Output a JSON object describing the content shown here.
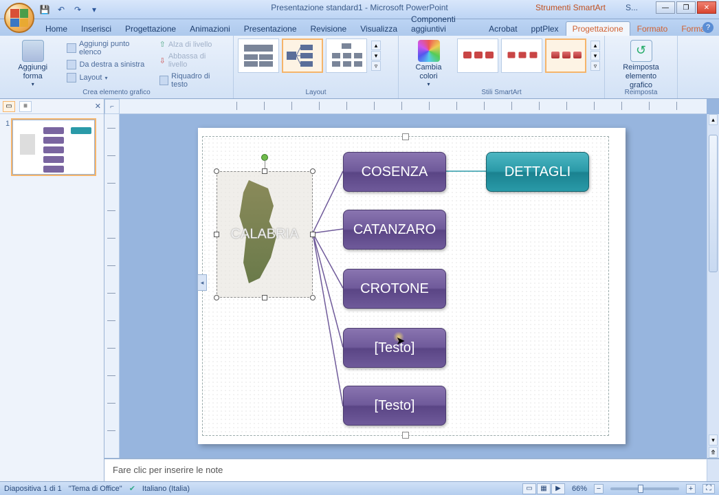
{
  "title": "Presentazione standard1 - Microsoft PowerPoint",
  "context_tool_title": "Strumenti SmartArt",
  "right_corner_label": "S...",
  "window_buttons": {
    "min": "—",
    "max": "❐",
    "close": "✕"
  },
  "tabs": {
    "items": [
      "Home",
      "Inserisci",
      "Progettazione",
      "Animazioni",
      "Presentazione",
      "Revisione",
      "Visualizza",
      "Componenti aggiuntivi",
      "Acrobat",
      "pptPlex"
    ],
    "context": [
      "Progettazione",
      "Formato",
      "Formato"
    ],
    "active_context_index": 0
  },
  "ribbon": {
    "group1": {
      "title": "Crea elemento grafico",
      "add_shape": "Aggiungi forma",
      "add_bullet": "Aggiungi punto elenco",
      "rtl": "Da destra a sinistra",
      "layout": "Layout",
      "promote": "Alza di livello",
      "demote": "Abbassa di livello",
      "text_pane": "Riquadro di testo"
    },
    "group2": {
      "title": "Layout"
    },
    "group3": {
      "title": "Stili SmartArt",
      "change_colors": "Cambia colori"
    },
    "group4": {
      "title": "Reimposta",
      "reset": "Reimposta elemento grafico"
    }
  },
  "slide_panel": {
    "slide_number": "1"
  },
  "smartart": {
    "root": "CALABRIA",
    "children": [
      "COSENZA",
      "CATANZARO",
      "CROTONE",
      "[Testo]",
      "[Testo]"
    ],
    "detail": "DETTAGLI"
  },
  "notes_placeholder": "Fare clic per inserire le note",
  "status": {
    "slide_of": "Diapositiva 1 di 1",
    "theme": "\"Tema di Office\"",
    "lang": "Italiano (Italia)",
    "zoom": "66%"
  }
}
